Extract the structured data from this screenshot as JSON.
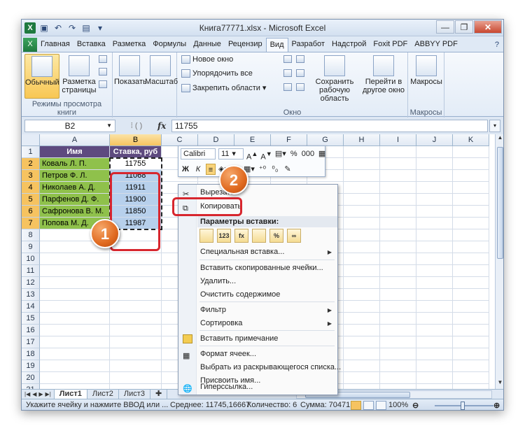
{
  "window": {
    "title": "Книга77771.xlsx - Microsoft Excel",
    "app_icon": "X",
    "close_label": "✕",
    "min_label": "—",
    "max_label": "❐"
  },
  "tabs": [
    "Главная",
    "Вставка",
    "Разметка",
    "Формулы",
    "Данные",
    "Рецензир",
    "Вид",
    "Разработ",
    "Надстрой",
    "Foxit PDF",
    "ABBYY PDF"
  ],
  "active_tab": "Вид",
  "ribbon": {
    "group1": {
      "label": "Режимы просмотра книги",
      "normal": "Обычный",
      "page_layout": "Разметка страницы"
    },
    "group2": {
      "show": "Показать",
      "zoom": "Масштаб"
    },
    "group3": {
      "label": "Окно",
      "new_window": "Новое окно",
      "arrange_all": "Упорядочить все",
      "freeze": "Закрепить области",
      "save_ws": "Сохранить рабочую область",
      "switch": "Перейти в другое окно"
    },
    "group4": {
      "label": "Макросы",
      "macros": "Макросы"
    }
  },
  "formula_bar": {
    "name_box": "B2",
    "fx": "fx",
    "value": "11755"
  },
  "columns": [
    "A",
    "B",
    "C",
    "D",
    "E",
    "F",
    "G",
    "H",
    "I",
    "J",
    "K"
  ],
  "rows": [
    "1",
    "2",
    "3",
    "4",
    "5",
    "6",
    "7",
    "8",
    "9",
    "10",
    "11",
    "12",
    "13",
    "14",
    "15",
    "16",
    "17",
    "18",
    "19",
    "20",
    "21"
  ],
  "table": {
    "header_name": "Имя",
    "header_rate": "Ставка, руб",
    "names": [
      "Коваль Л. П.",
      "Петров Ф. Л.",
      "Николаев А. Д.",
      "Парфенов Д. Ф.",
      "Сафронова В. М.",
      "Попова М. Д."
    ],
    "rates": [
      "11755",
      "11068",
      "11911",
      "11900",
      "11850",
      "11987"
    ]
  },
  "mini_toolbar": {
    "font": "Calibri",
    "size": "11",
    "bold": "Ж",
    "italic": "К",
    "percent": "%",
    "thousands": "000"
  },
  "context_menu": {
    "cut": "Вырезать",
    "copy": "Копировать",
    "paste_options": "Параметры вставки:",
    "paste_special": "Специальная вставка...",
    "insert_copied": "Вставить скопированные ячейки...",
    "delete": "Удалить...",
    "clear": "Очистить содержимое",
    "filter": "Фильтр",
    "sort": "Сортировка",
    "insert_comment": "Вставить примечание",
    "format_cells": "Формат ячеек...",
    "pick_list": "Выбрать из раскрывающегося списка...",
    "define_name": "Присвоить имя...",
    "hyperlink": "Гиперссылка...",
    "paste_icons": [
      "",
      "123",
      "fx",
      "",
      "%",
      "∞"
    ]
  },
  "sheets": [
    "Лист1",
    "Лист2",
    "Лист3"
  ],
  "active_sheet": "Лист1",
  "status": {
    "message": "Укажите ячейку и нажмите ВВОД или ...",
    "average": "Среднее: 11745,16667",
    "count": "Количество: 6",
    "sum": "Сумма: 70471",
    "zoom": "100%"
  },
  "callouts": {
    "one": "1",
    "two": "2"
  },
  "colors": {
    "header_bg": "#5e4a7f",
    "name_bg": "#8fc14b",
    "rate_bg": "#b7d0ec",
    "callout": "#d7262e"
  }
}
